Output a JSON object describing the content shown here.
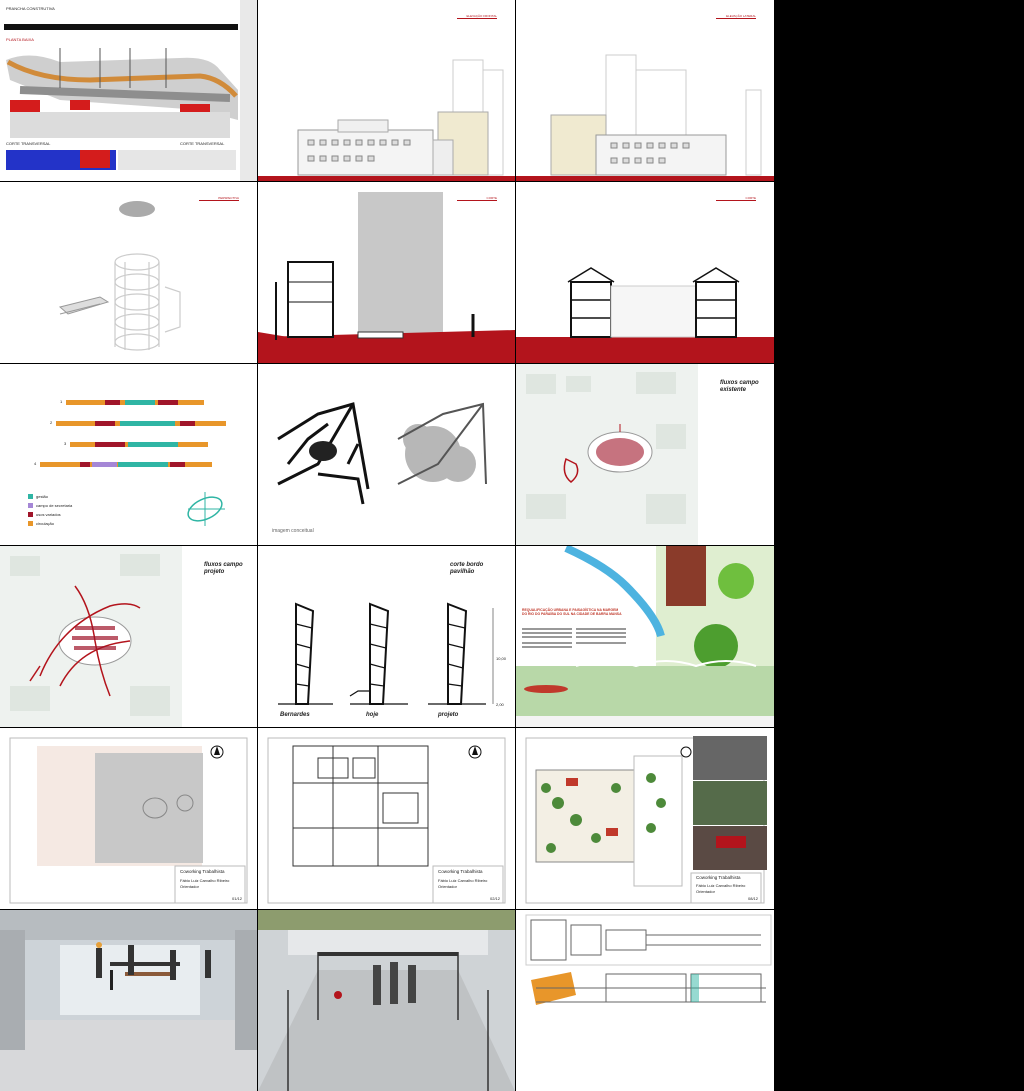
{
  "colors": {
    "accent_red": "#b3141c",
    "teal": "#2fb5a4",
    "orange": "#e8962a",
    "purple": "#a587d6",
    "dark_red": "#a0152a"
  },
  "tiles": [
    {
      "id": "t1",
      "label": "PRANCHA CONSTRUTIVA",
      "sub": "PLANTA BAIXA",
      "cap1": "CORTE TRANSVERSAL",
      "cap2": "CORTE TRANSVERSAL"
    },
    {
      "id": "t2",
      "label": "ELEVAÇÃO FRONTAL"
    },
    {
      "id": "t3",
      "label": "ELEVAÇÃO LATERAL"
    },
    {
      "id": "t4",
      "label": "PERSPECTIVA"
    },
    {
      "id": "t5",
      "label": "CORTE"
    },
    {
      "id": "t6",
      "label": "CORTE"
    },
    {
      "id": "t7",
      "rows": [
        "1",
        "2",
        "3",
        "4"
      ],
      "legend": [
        "gestão",
        "campo de secretaria",
        "usos variados",
        "circulação"
      ]
    },
    {
      "id": "t8",
      "caption": "imagem conceitual"
    },
    {
      "id": "t9",
      "title1": "fluxos campo",
      "title2": "existente"
    },
    {
      "id": "t10",
      "title1": "fluxos campo",
      "title2": "projeto"
    },
    {
      "id": "t11",
      "title1": "corte bordo",
      "title2": "pavilhão",
      "labels": [
        "Bernardes",
        "hoje",
        "projeto"
      ],
      "dims": [
        "10,00",
        "2,00"
      ]
    },
    {
      "id": "t12",
      "title": "REQUALIFICAÇÃO URBANA E PAISAGÍSTICA NA MARGEM DO RIO DO PARAÍBA DO SUL NA CIDADE DE BARRA MANSA"
    },
    {
      "id": "t13",
      "title": "Coworking Trabalhista",
      "names": [
        "Fábio Luiz Carvalho Ribeiro",
        "Orientador"
      ],
      "sheet": "01/12"
    },
    {
      "id": "t14",
      "title": "Coworking Trabalhista",
      "names": [
        "Fábio Luiz Carvalho Ribeiro",
        "Orientador"
      ],
      "sheet": "02/12"
    },
    {
      "id": "t15",
      "title": "Coworking Trabalhista",
      "names": [
        "Fábio Luiz Carvalho Ribeiro",
        "Orientador"
      ],
      "sheet": "08/12"
    },
    {
      "id": "t16",
      "label": ""
    },
    {
      "id": "t17",
      "label": ""
    },
    {
      "id": "t18",
      "label": ""
    }
  ]
}
